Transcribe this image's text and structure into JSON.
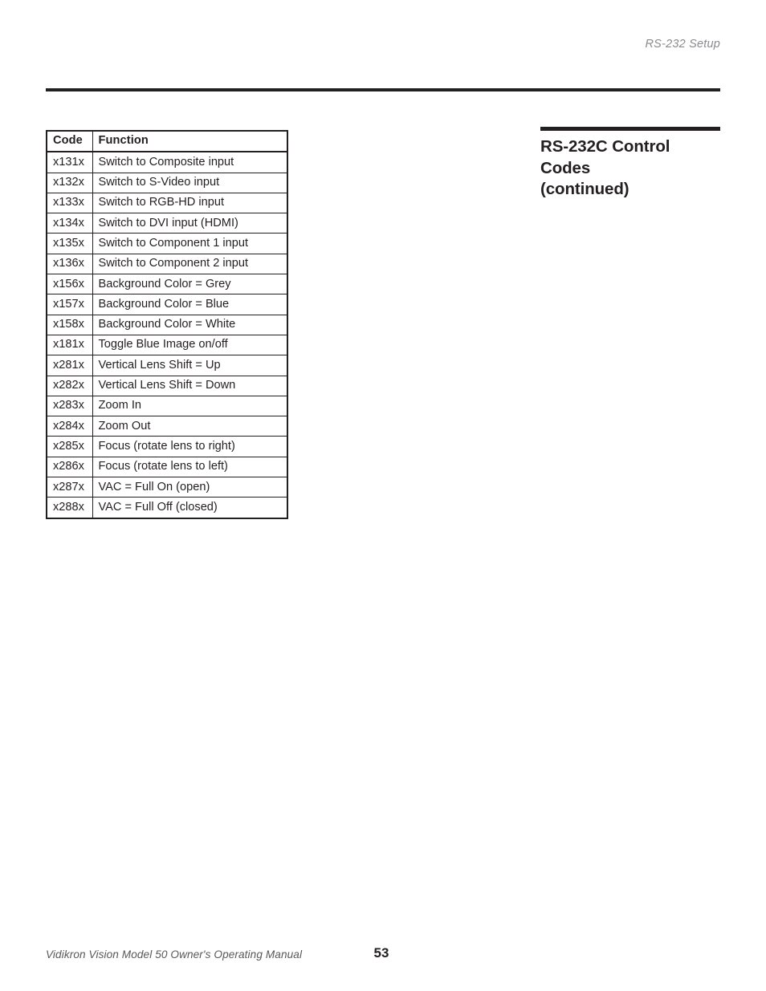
{
  "page": {
    "running_header": "RS-232 Setup",
    "footer_manual": "Vidikron Vision Model 50 Owner's Operating Manual",
    "footer_page_number": "53",
    "text_color": "#231f20",
    "header_color": "#8a8a8e",
    "background": "#ffffff"
  },
  "side_heading": {
    "line1": "RS-232C Control",
    "line2": "Codes",
    "line3": "(continued)"
  },
  "codes_table": {
    "columns": [
      "Code",
      "Function"
    ],
    "rows": [
      {
        "code": "x131x",
        "function": "Switch to Composite input"
      },
      {
        "code": "x132x",
        "function": "Switch to S-Video input"
      },
      {
        "code": "x133x",
        "function": "Switch to RGB-HD input"
      },
      {
        "code": "x134x",
        "function": "Switch to DVI input (HDMI)"
      },
      {
        "code": "x135x",
        "function": "Switch to Component 1 input"
      },
      {
        "code": "x136x",
        "function": "Switch to Component 2 input"
      },
      {
        "code": "x156x",
        "function": "Background Color = Grey"
      },
      {
        "code": "x157x",
        "function": "Background Color = Blue"
      },
      {
        "code": "x158x",
        "function": "Background Color = White"
      },
      {
        "code": "x181x",
        "function": "Toggle Blue Image on/off"
      },
      {
        "code": "x281x",
        "function": "Vertical Lens Shift = Up"
      },
      {
        "code": "x282x",
        "function": "Vertical Lens Shift = Down"
      },
      {
        "code": "x283x",
        "function": "Zoom In"
      },
      {
        "code": "x284x",
        "function": "Zoom Out"
      },
      {
        "code": "x285x",
        "function": "Focus (rotate lens to right)"
      },
      {
        "code": "x286x",
        "function": "Focus (rotate lens to left)"
      },
      {
        "code": "x287x",
        "function": "VAC = Full On (open)"
      },
      {
        "code": "x288x",
        "function": "VAC = Full Off (closed)"
      }
    ]
  }
}
